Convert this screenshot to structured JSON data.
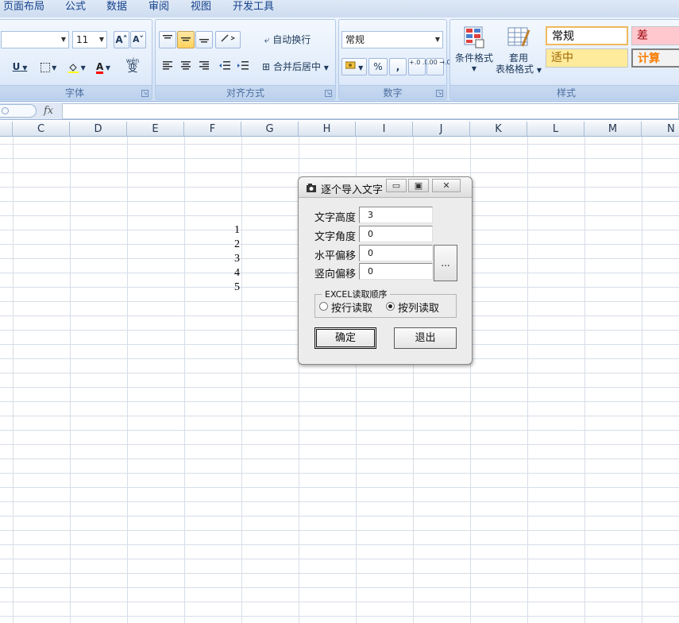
{
  "menu": [
    "页面布局",
    "公式",
    "数据",
    "审阅",
    "视图",
    "开发工具"
  ],
  "ribbon": {
    "font": {
      "label": "字体",
      "font_size": "11",
      "grow_label": "A˄",
      "shrink_label": "A˅",
      "underline_label": "U",
      "font_color_label": "A",
      "phonetic_label": "wén",
      "phonetic_char": "变"
    },
    "align": {
      "label": "对齐方式",
      "wrap_label": "自动换行",
      "merge_label": "合并后居中"
    },
    "number": {
      "label": "数字",
      "format": "常规",
      "percent_label": "%",
      "comma_label": ",",
      "inc_decimal_label": "+.0 .00",
      "dec_decimal_label": ".00 →.0"
    },
    "styles": {
      "label": "样式",
      "cond_format_label": "条件格式",
      "table_format_line1": "套用",
      "table_format_line2": "表格格式",
      "cells": [
        {
          "text": "常规",
          "bg": "#ffffff",
          "color": "#000000"
        },
        {
          "text": "差",
          "bg": "#ffc7ce",
          "color": "#9c0006"
        },
        {
          "text": "适中",
          "bg": "#ffeb9c",
          "color": "#9c6500"
        },
        {
          "text": "计算",
          "bg": "#f2f2f2",
          "color": "#fa7d00"
        }
      ]
    }
  },
  "formula_bar": {
    "fx_label": "fx"
  },
  "columns": [
    "C",
    "D",
    "E",
    "F",
    "G",
    "H",
    "I",
    "J",
    "K",
    "L",
    "M",
    "N"
  ],
  "cells": [
    "1",
    "2",
    "3",
    "4",
    "5"
  ],
  "dialog": {
    "title": "逐个导入文字",
    "fields": [
      {
        "label": "文字高度",
        "value": "3"
      },
      {
        "label": "文字角度",
        "value": "0"
      },
      {
        "label": "水平偏移",
        "value": "0"
      },
      {
        "label": "竖向偏移",
        "value": "0"
      }
    ],
    "ellipsis_label": "...",
    "group_label": "EXCEL读取顺序",
    "option_row": "按行读取",
    "option_col": "按列读取",
    "selected_option": "按列读取",
    "ok_label": "确定",
    "exit_label": "退出"
  },
  "colors": {
    "ribbon_text": "#15428b",
    "grid_line": "#d7dee8",
    "font_color_swatch": "#ff0000",
    "fill_color_swatch": "#ffff00"
  }
}
